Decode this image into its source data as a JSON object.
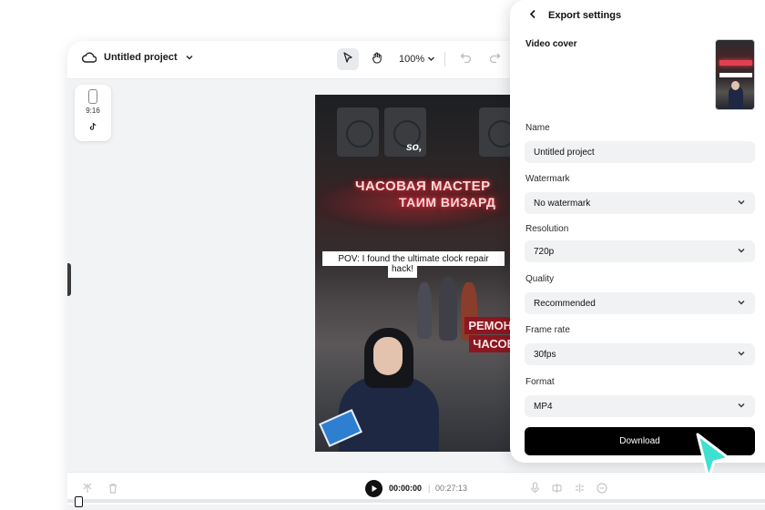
{
  "topbar": {
    "project_name": "Untitled project",
    "zoom": "100%"
  },
  "ratio": {
    "label": "9:16"
  },
  "canvas": {
    "overlay_so": "so,",
    "caption_line1": "POV: I found the ultimate clock repair",
    "caption_line2": "hack!",
    "sign_line1": "ЧАСОВАЯ МАСТЕР",
    "sign_line2": "ТАИМ ВИЗАРД",
    "sign_line3": "РЕМОН",
    "sign_line4": "ЧАСОВ"
  },
  "playback": {
    "current": "00:00:00",
    "separator": "|",
    "total": "00:27:13"
  },
  "export": {
    "title": "Export settings",
    "video_cover_label": "Video cover",
    "name_label": "Name",
    "name_value": "Untitled project",
    "watermark_label": "Watermark",
    "watermark_value": "No watermark",
    "resolution_label": "Resolution",
    "resolution_value": "720p",
    "quality_label": "Quality",
    "quality_value": "Recommended",
    "framerate_label": "Frame rate",
    "framerate_value": "30fps",
    "format_label": "Format",
    "format_value": "MP4",
    "download_label": "Download"
  },
  "icons": {
    "cloud": "cloud-icon",
    "pointer": "pointer-icon",
    "hand": "hand-icon",
    "undo": "undo-icon",
    "redo": "redo-icon",
    "back": "back-arrow-icon",
    "chevron": "chevron-down-icon",
    "play": "play-icon",
    "tiktok": "tiktok-icon",
    "cursor": "mouse-cursor-icon"
  },
  "colors": {
    "accent_cursor": "#3ee0cf",
    "download_bg": "#000000",
    "field_bg": "#f1f2f4"
  }
}
